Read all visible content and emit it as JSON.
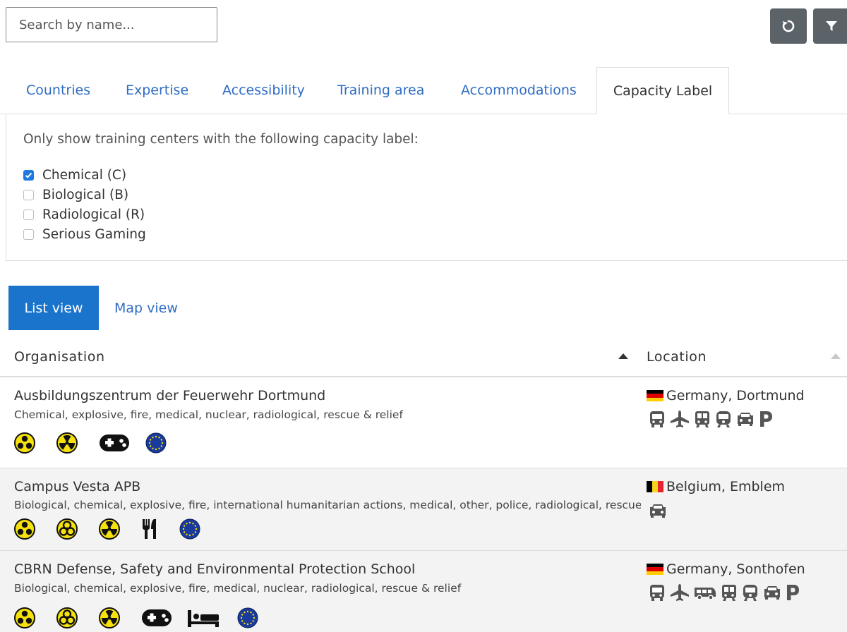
{
  "search": {
    "placeholder": "Search by name..."
  },
  "toolbar": {
    "reset_icon": "reset-icon",
    "filter_icon": "filter-icon"
  },
  "tabs": [
    {
      "label": "Countries"
    },
    {
      "label": "Expertise"
    },
    {
      "label": "Accessibility"
    },
    {
      "label": "Training area"
    },
    {
      "label": "Accommodations"
    },
    {
      "label": "Capacity Label",
      "active": true
    }
  ],
  "capacity_panel": {
    "intro": "Only show training centers with the following capacity label:",
    "options": [
      {
        "label": "Chemical (C)",
        "checked": true
      },
      {
        "label": "Biological (B)",
        "checked": false
      },
      {
        "label": "Radiological (R)",
        "checked": false
      },
      {
        "label": "Serious Gaming",
        "checked": false
      }
    ]
  },
  "views": {
    "list": "List view",
    "map": "Map view",
    "active": "list"
  },
  "table": {
    "col_org": "Organisation",
    "col_loc": "Location",
    "rows": [
      {
        "name": "Ausbildungszentrum der Feuerwehr Dortmund",
        "tags": "Chemical, explosive, fire, medical, nuclear, radiological, rescue & relief",
        "labels": [
          "chemical-icon",
          "radiological-icon",
          "gamepad-icon",
          "eu-icon"
        ],
        "location": "Germany, Dortmund",
        "flag": "de",
        "access": [
          "bus-icon",
          "airplane-icon",
          "train-icon",
          "tram-icon",
          "car-icon",
          "parking-icon"
        ]
      },
      {
        "name": "Campus Vesta APB",
        "tags": "Biological, chemical, explosive, fire, international humanitarian actions, medical, other, police, radiological, rescue & relief",
        "labels": [
          "chemical-icon",
          "biological-icon",
          "radiological-icon",
          "restaurant-icon",
          "eu-icon"
        ],
        "location": "Belgium, Emblem",
        "flag": "be",
        "access": [
          "car-icon"
        ]
      },
      {
        "name": "CBRN Defense, Safety and Environmental Protection School",
        "tags": "Biological, chemical, explosive, fire, medical, nuclear, radiological, rescue & relief",
        "labels": [
          "chemical-icon",
          "biological-icon",
          "radiological-icon",
          "gamepad-icon",
          "bed-icon",
          "eu-icon"
        ],
        "location": "Germany, Sonthofen",
        "flag": "de",
        "access": [
          "bus-icon",
          "airplane-icon",
          "shuttle-icon",
          "train-icon",
          "tram-icon",
          "car-icon",
          "parking-icon"
        ]
      }
    ]
  },
  "colors": {
    "accent": "#1a74cc",
    "link": "#2e6cc4",
    "hazard": "#f5e10c",
    "eu": "#1a3a9c"
  }
}
